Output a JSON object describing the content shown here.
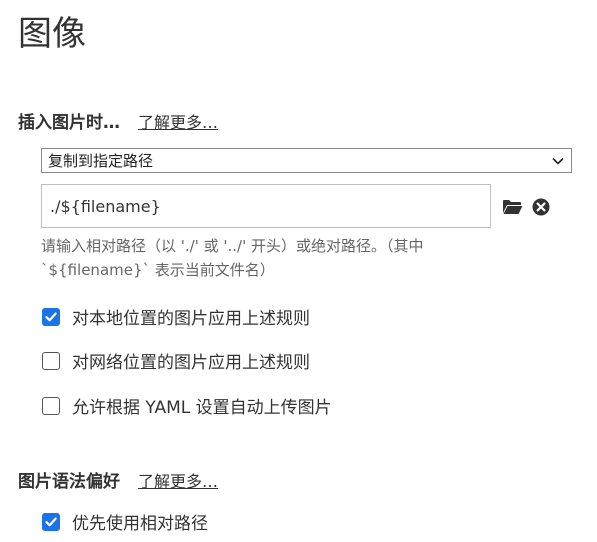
{
  "page": {
    "title": "图像"
  },
  "insert_section": {
    "title": "插入图片时…",
    "learn_more": "了解更多…",
    "select_value": "复制到指定路径",
    "path_value": "./${filename}",
    "hint": "请输入相对路径（以 './' 或 '../' 开头）或绝对路径。（其中\n`${filename}` 表示当前文件名）",
    "options": [
      {
        "label": "对本地位置的图片应用上述规则",
        "checked": true
      },
      {
        "label": "对网络位置的图片应用上述规则",
        "checked": false
      },
      {
        "label": "允许根据 YAML 设置自动上传图片",
        "checked": false
      }
    ]
  },
  "syntax_section": {
    "title": "图片语法偏好",
    "learn_more": "了解更多…",
    "options": [
      {
        "label": "优先使用相对路径",
        "checked": true
      }
    ]
  },
  "icons": {
    "folder": "folder-icon",
    "clear": "clear-icon",
    "dropdown": "chevron-down-icon",
    "check": "checkmark-icon"
  },
  "colors": {
    "accent": "#1a73e8",
    "text": "#333333",
    "hint": "#666666"
  }
}
